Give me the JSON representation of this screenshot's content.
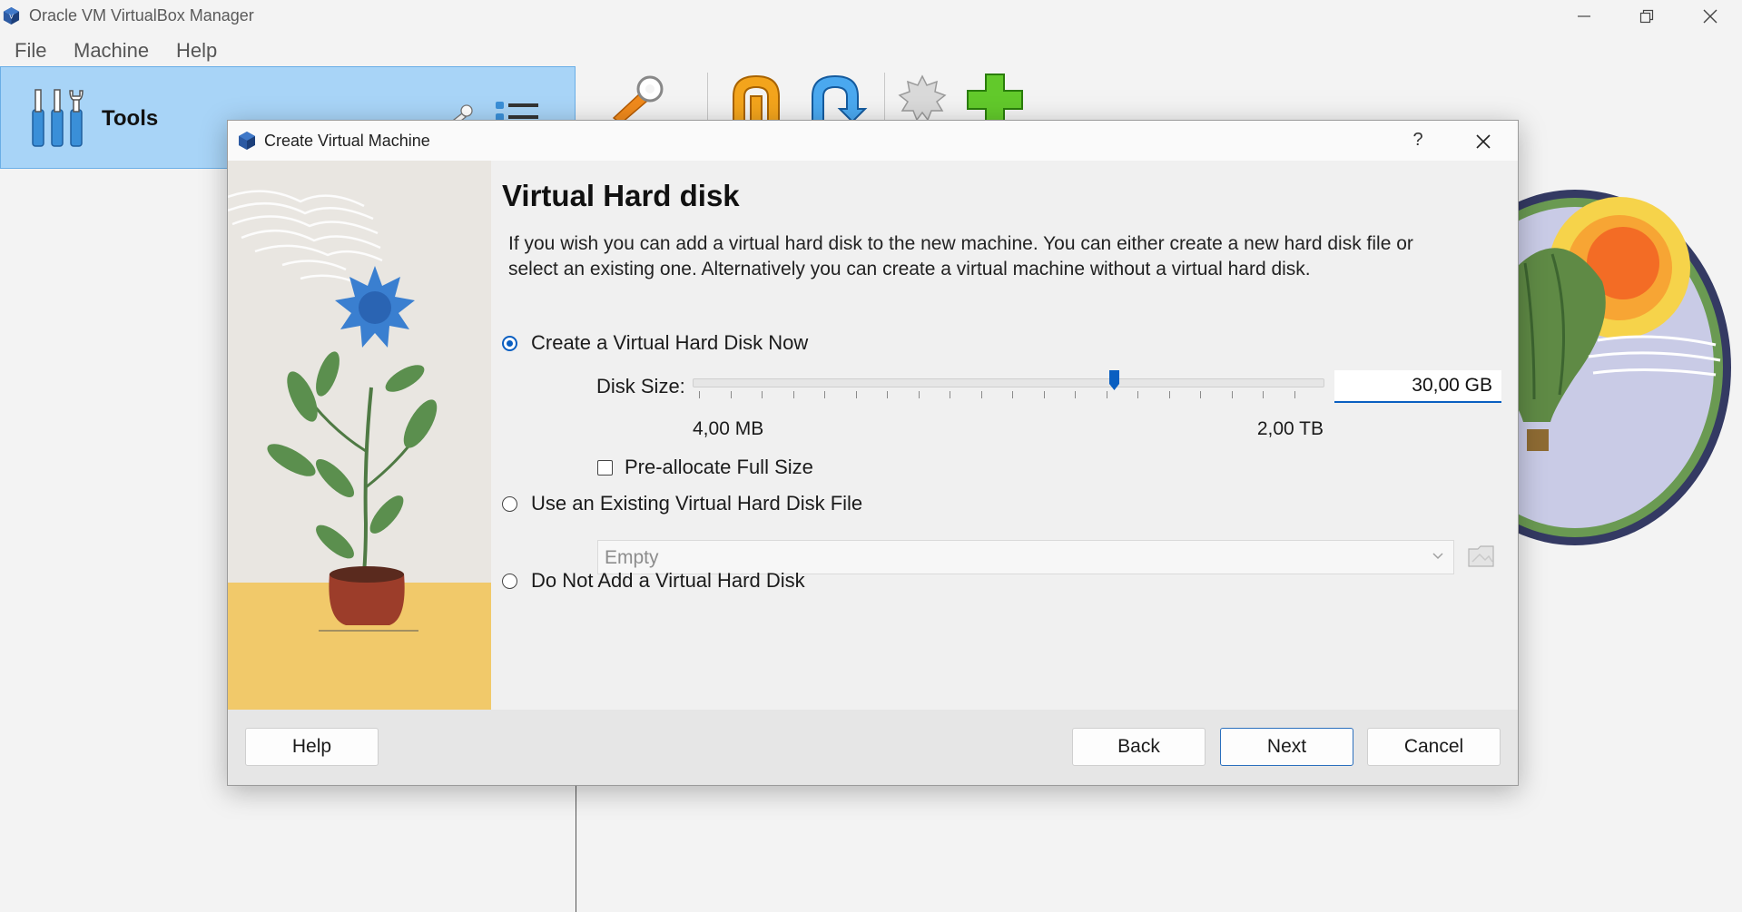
{
  "window": {
    "title": "Oracle VM VirtualBox Manager"
  },
  "menu": [
    "File",
    "Machine",
    "Help"
  ],
  "tools": {
    "label": "Tools"
  },
  "dialog": {
    "title": "Create Virtual Machine",
    "help_glyph": "?",
    "heading": "Virtual Hard disk",
    "description": "If you wish you can add a virtual hard disk to the new machine. You can either create a new hard disk file or select an existing one. Alternatively you can create a virtual machine without a virtual hard disk.",
    "options": {
      "create_now": "Create a Virtual Hard Disk Now",
      "use_existing": "Use an Existing Virtual Hard Disk File",
      "do_not_add": "Do Not Add a Virtual Hard Disk"
    },
    "selected_option": "create_now",
    "disk_size": {
      "label": "Disk Size:",
      "value": "30,00 GB",
      "min": "4,00 MB",
      "max": "2,00 TB",
      "slider_level": 0.67
    },
    "preallocate": {
      "label": "Pre-allocate Full Size",
      "checked": false
    },
    "existing_disk": {
      "value": "Empty"
    },
    "buttons": {
      "help": "Help",
      "back": "Back",
      "next": "Next",
      "cancel": "Cancel"
    }
  },
  "colors": {
    "accent": "#0a5fc1",
    "tools_panel": "#a8d4f7",
    "dialog_bg": "#f0f0f0"
  }
}
